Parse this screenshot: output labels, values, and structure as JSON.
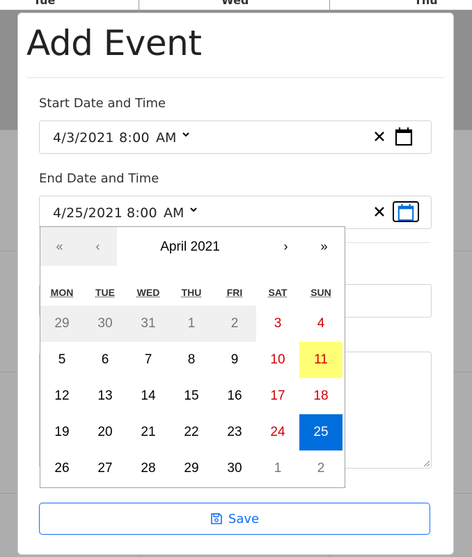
{
  "background": {
    "day_headers": [
      "Tue",
      "Wed",
      "Thu"
    ]
  },
  "modal": {
    "title": "Add Event",
    "start": {
      "label": "Start Date and Time",
      "date": "4/3/2021",
      "time": "8:00",
      "ampm": "AM"
    },
    "end": {
      "label": "End Date and Time",
      "date": "4/25/2021",
      "time": "8:00",
      "ampm": "AM"
    },
    "clear_symbol": "✕",
    "save_label": "Save"
  },
  "calendar": {
    "prev_year": "«",
    "prev_month": "‹",
    "month_label": "April 2021",
    "next_month": "›",
    "next_year": "»",
    "weekdays": [
      "MON",
      "TUE",
      "WED",
      "THU",
      "FRI",
      "SAT",
      "SUN"
    ],
    "weeks": [
      [
        "29",
        "30",
        "31",
        "1",
        "2",
        "3",
        "4"
      ],
      [
        "5",
        "6",
        "7",
        "8",
        "9",
        "10",
        "11"
      ],
      [
        "12",
        "13",
        "14",
        "15",
        "16",
        "17",
        "18"
      ],
      [
        "19",
        "20",
        "21",
        "22",
        "23",
        "24",
        "25"
      ],
      [
        "26",
        "27",
        "28",
        "29",
        "30",
        "1",
        "2"
      ]
    ],
    "colors": {
      "weekend": "#d10000",
      "today": "#ffff76",
      "selected": "#006edc",
      "neighbor": "#757575"
    }
  }
}
